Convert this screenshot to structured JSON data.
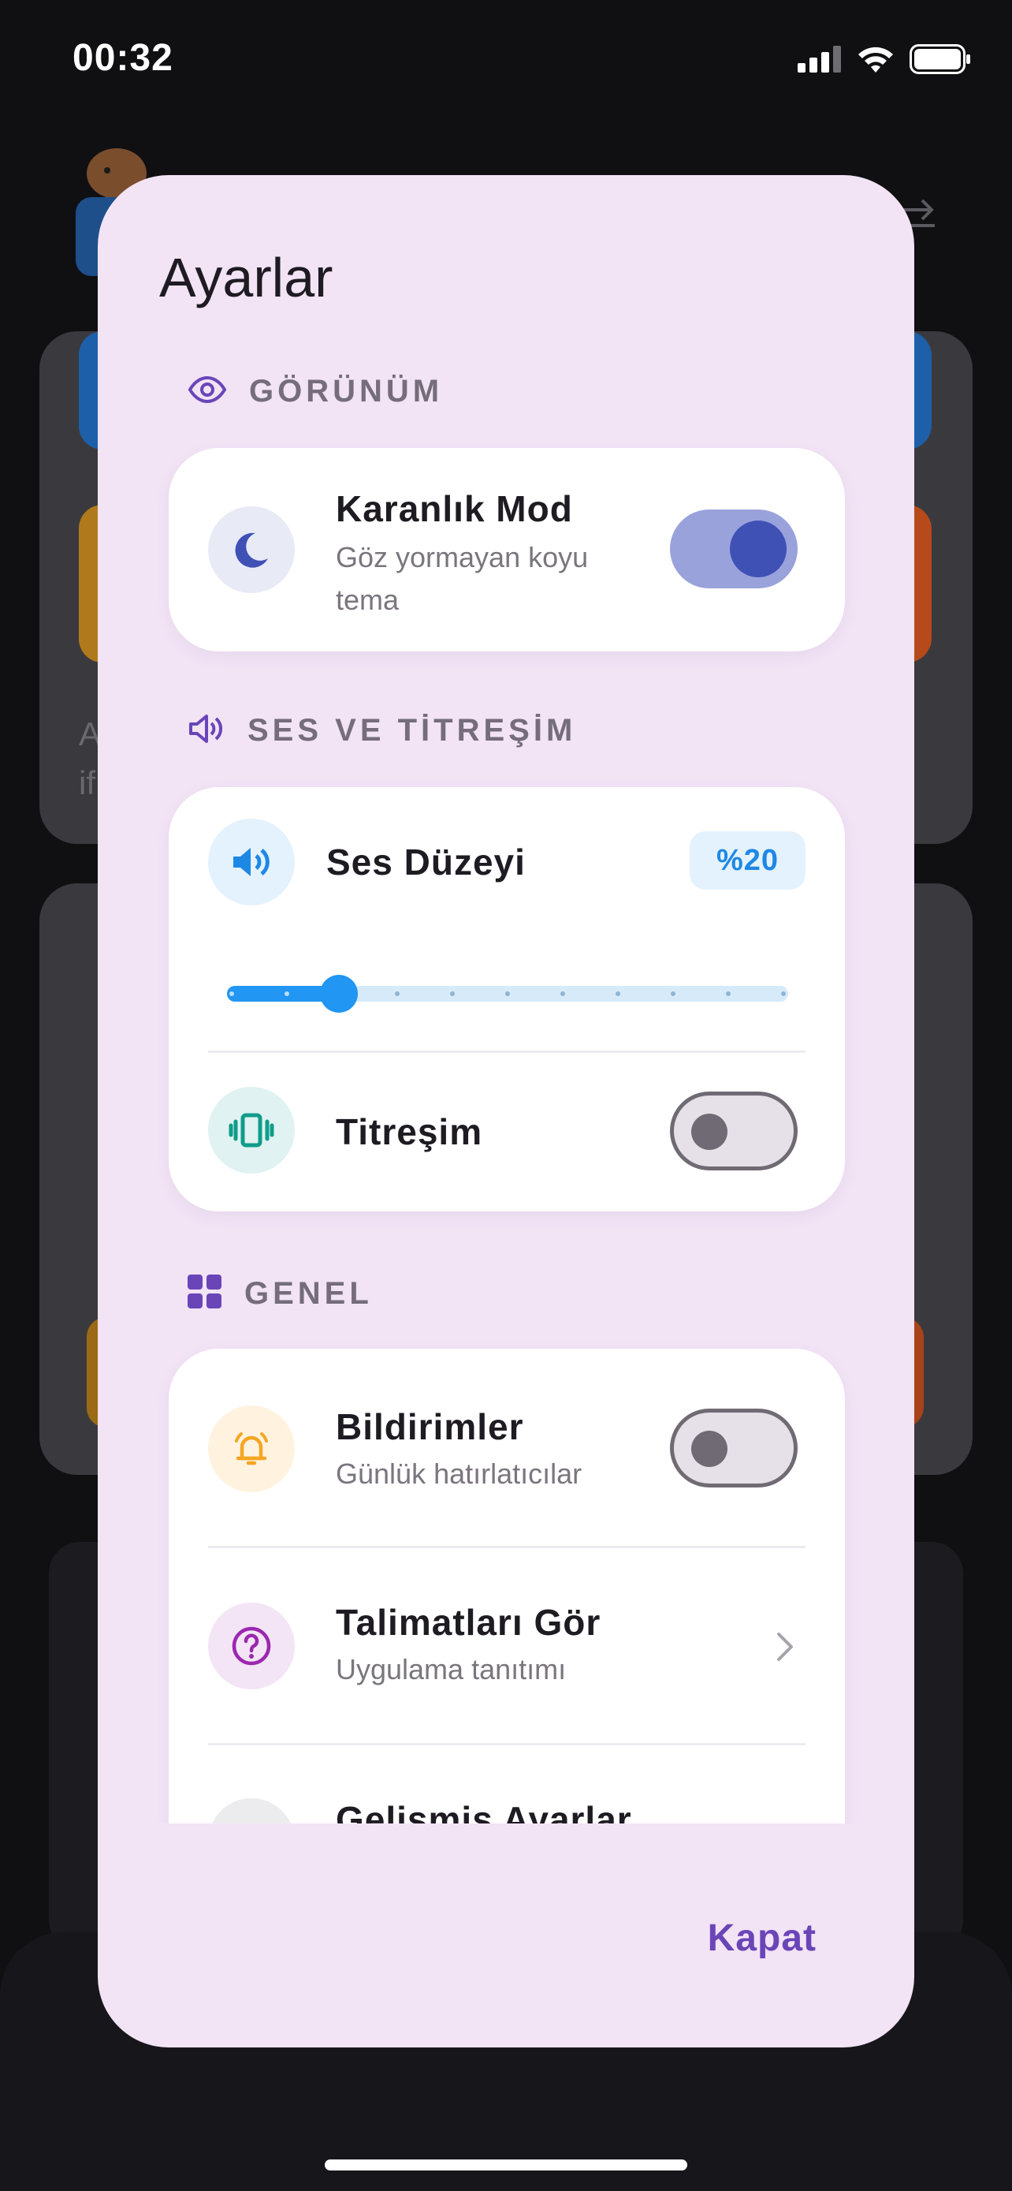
{
  "status_bar": {
    "time": "00:32",
    "icons": [
      "cellular-signal-icon",
      "wifi-icon",
      "battery-icon"
    ]
  },
  "background": {
    "card_text_line1": "A",
    "card_text_line2": "if"
  },
  "dialog": {
    "title": "Ayarlar",
    "sections": {
      "appearance": {
        "header": "GÖRÜNÜM",
        "icon": "eye-icon",
        "dark_mode": {
          "title": "Karanlık Mod",
          "subtitle_line1": "Göz yormayan koyu",
          "subtitle_line2": "tema",
          "icon": "moon-icon",
          "enabled": true
        }
      },
      "sound": {
        "header": "SES VE TİTREŞİM",
        "icon": "speaker-icon",
        "volume": {
          "title": "Ses Düzeyi",
          "badge": "%20",
          "value": 0.2,
          "icon": "volume-icon"
        },
        "vibration": {
          "title": "Titreşim",
          "icon": "vibration-icon",
          "enabled": false
        }
      },
      "general": {
        "header": "GENEL",
        "icon": "grid-icon",
        "notifications": {
          "title": "Bildirimler",
          "subtitle": "Günlük hatırlatıcılar",
          "icon": "bell-icon",
          "enabled": false
        },
        "instructions": {
          "title": "Talimatları Gör",
          "subtitle": "Uygulama tanıtımı",
          "icon": "help-circle-icon"
        },
        "advanced": {
          "title": "Gelişmiş Ayarlar"
        }
      }
    },
    "close_label": "Kapat"
  },
  "colors": {
    "dialog_bg": "#f2e3f5",
    "accent_primary": "#6a45b8",
    "toggle_on": "#3f51b5",
    "slider": "#2196f3",
    "vibration_icon": "#0f9d8a",
    "notification_icon": "#f5a623",
    "help_icon": "#9c27b0"
  }
}
